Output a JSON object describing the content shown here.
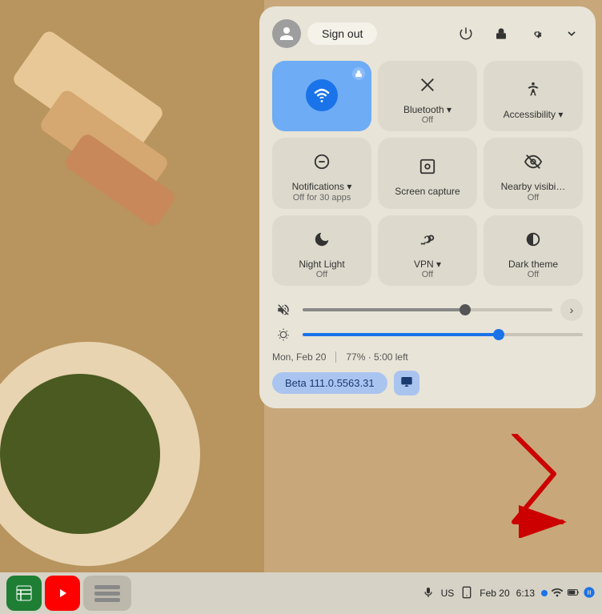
{
  "wallpaper": {
    "alt": "abstract wallpaper"
  },
  "header": {
    "avatar_icon": "person-icon",
    "sign_out_label": "Sign out",
    "power_icon": "power-icon",
    "lock_icon": "lock-icon",
    "settings_icon": "settings-icon",
    "chevron_icon": "chevron-down-icon"
  },
  "tiles": [
    {
      "id": "wifi",
      "icon": "📶",
      "label": "",
      "sublabel": "",
      "active": true
    },
    {
      "id": "bluetooth",
      "icon": "✕",
      "label": "Bluetooth ▾",
      "sublabel": "Off",
      "active": false
    },
    {
      "id": "accessibility",
      "icon": "♿",
      "label": "Accessibility ▾",
      "sublabel": "",
      "active": false
    },
    {
      "id": "notifications",
      "icon": "⊖",
      "label": "Notifications ▾",
      "sublabel": "Off for 30 apps",
      "active": false
    },
    {
      "id": "screencapture",
      "icon": "⊡",
      "label": "Screen capture",
      "sublabel": "",
      "active": false
    },
    {
      "id": "nearbyvisi",
      "icon": "👁",
      "label": "Nearby visibi…",
      "sublabel": "Off",
      "active": false
    },
    {
      "id": "nightlight",
      "icon": "🌙",
      "label": "Night Light",
      "sublabel": "Off",
      "active": false
    },
    {
      "id": "vpn",
      "icon": "🔑",
      "label": "VPN ▾",
      "sublabel": "Off",
      "active": false
    },
    {
      "id": "darktheme",
      "icon": "◑",
      "label": "Dark theme",
      "sublabel": "Off",
      "active": false
    }
  ],
  "sliders": [
    {
      "id": "volume",
      "icon": "mute-icon",
      "fill_percent": 65,
      "is_blue": false
    },
    {
      "id": "brightness",
      "icon": "brightness-icon",
      "fill_percent": 70,
      "is_blue": true
    }
  ],
  "footer": {
    "date": "Mon, Feb 20",
    "battery": "77% · 5:00 left"
  },
  "beta_badge": {
    "label": "Beta 111.0.5563.31",
    "icon": "feedback-icon"
  },
  "taskbar": {
    "apps": [
      {
        "id": "sheets",
        "icon": "🗒",
        "label": "Google Sheets"
      },
      {
        "id": "youtube",
        "icon": "▶",
        "label": "YouTube"
      }
    ],
    "middle": {
      "id": "stack",
      "label": ""
    },
    "mic_icon": "mic-icon",
    "locale": "US",
    "device_icon": "device-icon",
    "date": "Feb 20",
    "time": "6:13",
    "notification_count": "1",
    "wifi_icon": "wifi-icon",
    "battery_icon": "battery-icon",
    "blue_icon": "blue-icon"
  }
}
